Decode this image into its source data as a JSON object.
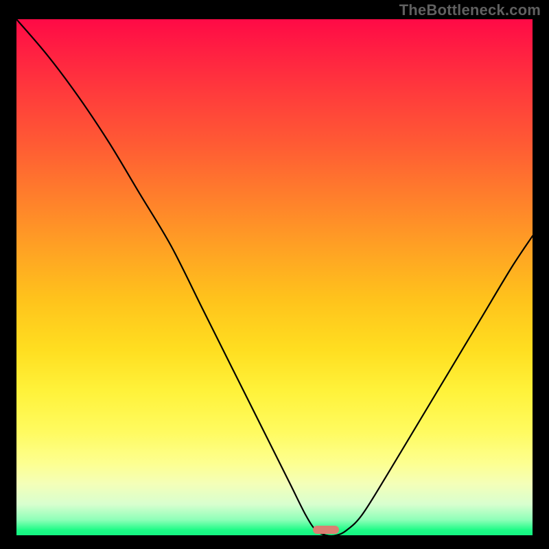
{
  "watermark": {
    "text": "TheBottleneck.com"
  },
  "chart_data": {
    "type": "line",
    "title": "",
    "xlabel": "",
    "ylabel": "",
    "xlim": [
      0,
      100
    ],
    "ylim": [
      0,
      100
    ],
    "grid": false,
    "legend": false,
    "background": "rainbow-vertical",
    "curve_points": [
      {
        "x": 0,
        "y": 100
      },
      {
        "x": 6,
        "y": 93
      },
      {
        "x": 12,
        "y": 85
      },
      {
        "x": 18,
        "y": 76
      },
      {
        "x": 24,
        "y": 66
      },
      {
        "x": 30,
        "y": 56
      },
      {
        "x": 36,
        "y": 44
      },
      {
        "x": 42,
        "y": 32
      },
      {
        "x": 48,
        "y": 20
      },
      {
        "x": 53,
        "y": 10
      },
      {
        "x": 56,
        "y": 4
      },
      {
        "x": 58,
        "y": 1
      },
      {
        "x": 60,
        "y": 0
      },
      {
        "x": 62,
        "y": 0
      },
      {
        "x": 64,
        "y": 1
      },
      {
        "x": 67,
        "y": 4
      },
      {
        "x": 72,
        "y": 12
      },
      {
        "x": 78,
        "y": 22
      },
      {
        "x": 84,
        "y": 32
      },
      {
        "x": 90,
        "y": 42
      },
      {
        "x": 96,
        "y": 52
      },
      {
        "x": 100,
        "y": 58
      }
    ],
    "marker": {
      "x_center": 60,
      "x_width": 4,
      "y": 0.5,
      "color": "#da8072"
    },
    "gradient_stops": [
      {
        "pct": 0,
        "color": "#ff0a46"
      },
      {
        "pct": 50,
        "color": "#ffb020"
      },
      {
        "pct": 80,
        "color": "#fffb60"
      },
      {
        "pct": 100,
        "color": "#14f582"
      }
    ]
  }
}
